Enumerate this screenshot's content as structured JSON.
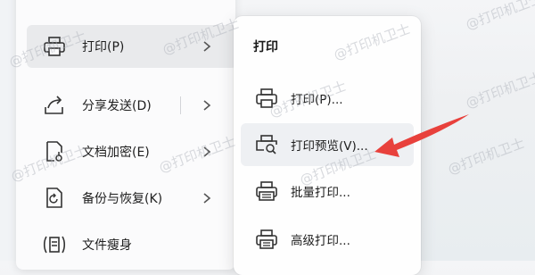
{
  "left_menu": {
    "items": [
      {
        "label": "打印(P)",
        "icon": "printer-icon",
        "active": true,
        "has_submenu": true
      },
      {
        "label": "分享发送(D)",
        "icon": "share-icon",
        "has_submenu": true
      },
      {
        "label": "文档加密(E)",
        "icon": "encrypt-icon",
        "has_submenu": true
      },
      {
        "label": "备份与恢复(K)",
        "icon": "backup-icon",
        "has_submenu": true
      },
      {
        "label": "文件瘦身",
        "icon": "slim-icon",
        "has_submenu": false
      }
    ]
  },
  "submenu": {
    "title": "打印",
    "items": [
      {
        "label": "打印(P)...",
        "icon": "printer-icon"
      },
      {
        "label": "打印预览(V)...",
        "icon": "print-preview-icon",
        "active": true
      },
      {
        "label": "批量打印...",
        "icon": "batch-print-icon"
      },
      {
        "label": "高级打印...",
        "icon": "advanced-print-icon"
      }
    ]
  },
  "watermark": {
    "text": "@打印机卫士"
  },
  "colors": {
    "arrow": "#e8413c",
    "active_bg": "#e9eaec"
  }
}
